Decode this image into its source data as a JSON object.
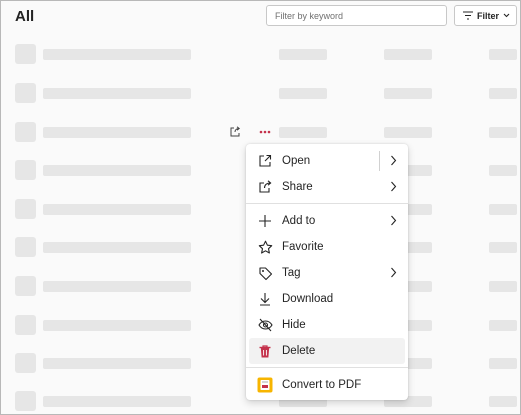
{
  "header": {
    "title": "All",
    "search_placeholder": "Filter by keyword",
    "filter_label": "Filter"
  },
  "context_menu": {
    "items": [
      {
        "label": "Open",
        "icon": "open-icon",
        "submenu": true
      },
      {
        "label": "Share",
        "icon": "share-icon",
        "submenu": true
      },
      {
        "label": "Add to",
        "icon": "plus-icon",
        "submenu": true
      },
      {
        "label": "Favorite",
        "icon": "star-icon",
        "submenu": false
      },
      {
        "label": "Tag",
        "icon": "tag-icon",
        "submenu": true
      },
      {
        "label": "Download",
        "icon": "download-icon",
        "submenu": false
      },
      {
        "label": "Hide",
        "icon": "eye-off-icon",
        "submenu": false
      },
      {
        "label": "Delete",
        "icon": "trash-icon",
        "submenu": false,
        "highlighted": true
      },
      {
        "label": "Convert to PDF",
        "icon": "pdf-icon",
        "submenu": false
      }
    ]
  },
  "colors": {
    "accent_red": "#c4314b",
    "skeleton": "#e6e6e6",
    "pdf_orange": "#f7b500"
  }
}
